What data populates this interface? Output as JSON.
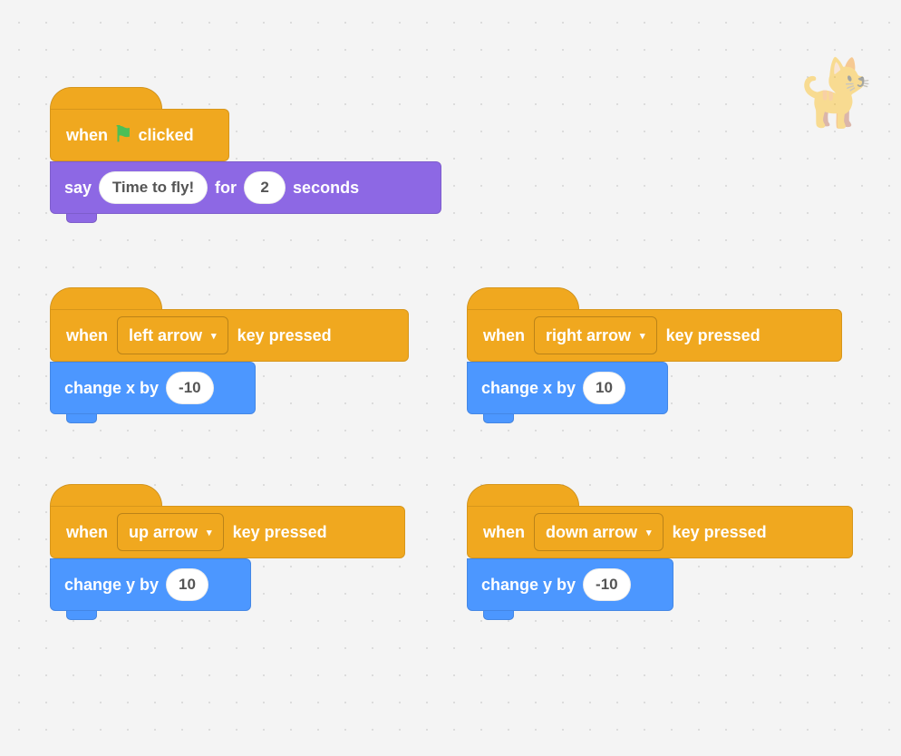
{
  "colors": {
    "events": "#f0a81f",
    "looks": "#8d68e4",
    "motion": "#4c97ff",
    "flag": "#4cbf56"
  },
  "text": {
    "when": "when",
    "clicked": "clicked",
    "key_pressed": "key pressed",
    "say": "say",
    "for": "for",
    "seconds": "seconds",
    "change_x": "change x by",
    "change_y": "change y by"
  },
  "scripts": {
    "flag": {
      "say_text": "Time to fly!",
      "say_secs": "2"
    },
    "left": {
      "key": "left arrow",
      "dx": "-10"
    },
    "right": {
      "key": "right arrow",
      "dx": "10"
    },
    "up": {
      "key": "up arrow",
      "dy": "10"
    },
    "down": {
      "key": "down arrow",
      "dy": "-10"
    }
  },
  "icons": {
    "flag": "⚑",
    "dropdown": "▾",
    "cat": "🐈"
  }
}
